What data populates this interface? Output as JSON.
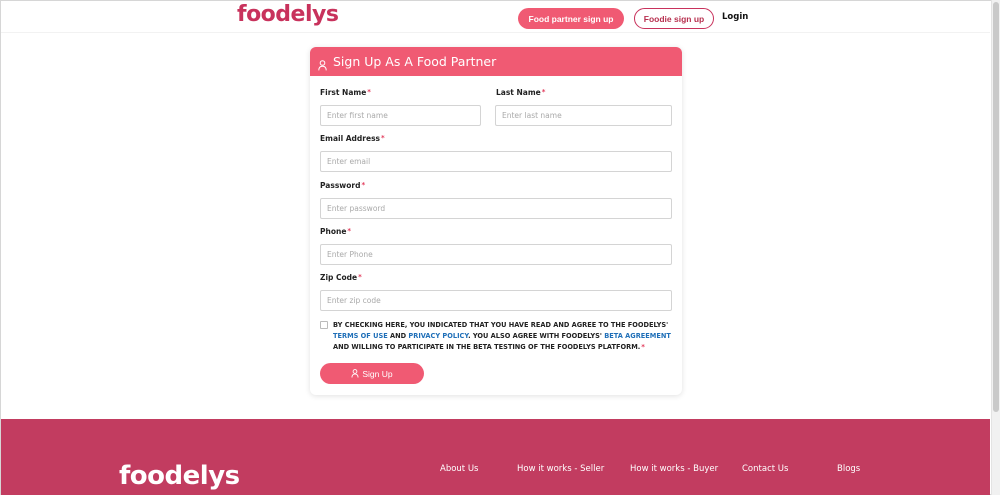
{
  "header": {
    "logo": "foodelys",
    "partner_signup": "Food partner sign up",
    "foodie_signup": "Foodie sign up",
    "login": "Login"
  },
  "form": {
    "title": "Sign Up As A Food Partner",
    "required_mark": "*",
    "first_name": {
      "label": "First Name",
      "placeholder": "Enter first name",
      "value": ""
    },
    "last_name": {
      "label": "Last Name",
      "placeholder": "Enter last name",
      "value": ""
    },
    "email": {
      "label": "Email Address",
      "placeholder": "Enter email",
      "value": ""
    },
    "password": {
      "label": "Password",
      "placeholder": "Enter password",
      "value": ""
    },
    "phone": {
      "label": "Phone",
      "placeholder": "Enter Phone",
      "value": ""
    },
    "zip": {
      "label": "Zip Code",
      "placeholder": "Enter zip code",
      "value": ""
    },
    "terms": {
      "part1": "BY CHECKING HERE, YOU INDICATED THAT YOU HAVE READ AND AGREE TO THE FOODELYS'",
      "terms_link": "TERMS OF USE",
      "and": "AND",
      "privacy_link": "PRIVACY POLICY",
      "part2": ". YOU ALSO AGREE WITH FOODELYS'",
      "beta_link": "BETA AGREEMENT",
      "part3": "AND WILLING TO PARTICIPATE IN THE BETA TESTING OF THE FOODELYS PLATFORM.",
      "checked": false
    },
    "submit": "Sign Up"
  },
  "footer": {
    "logo": "foodelys",
    "links": [
      "About Us",
      "How it works - Seller",
      "How it works - Buyer",
      "Contact Us",
      "Blogs"
    ]
  },
  "colors": {
    "brand": "#c8325c",
    "accent": "#f05a73",
    "footer": "#c23c60",
    "link": "#1f6fb8"
  },
  "icons": {
    "form_title_icon": "user-icon",
    "submit_icon": "user-icon"
  }
}
